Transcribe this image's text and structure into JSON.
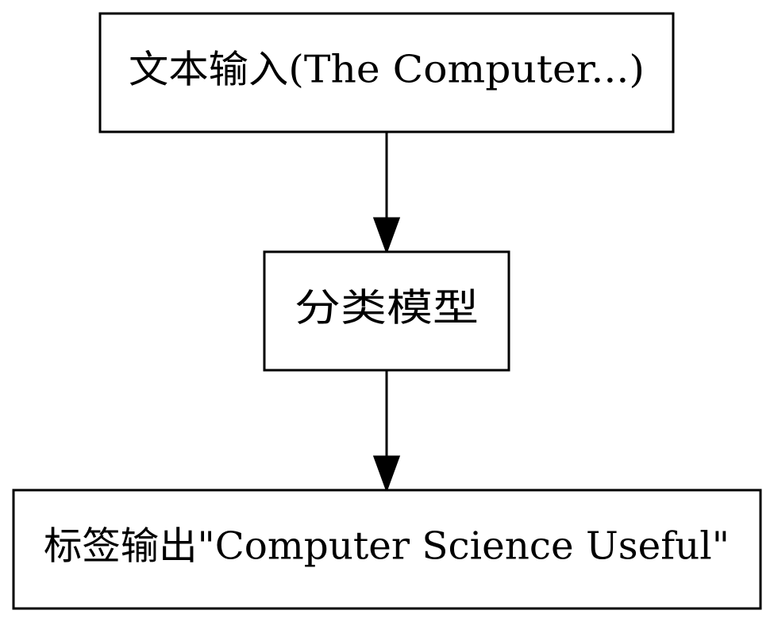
{
  "diagram": {
    "nodes": [
      {
        "id": "input",
        "label": "文本输入(The Computer...)"
      },
      {
        "id": "model",
        "label": "分类模型"
      },
      {
        "id": "output",
        "label": "标签输出\"Computer Science Useful\""
      }
    ],
    "edges": [
      {
        "from": "input",
        "to": "model"
      },
      {
        "from": "model",
        "to": "output"
      }
    ],
    "colors": {
      "stroke": "#000000",
      "fill": "#ffffff"
    }
  }
}
